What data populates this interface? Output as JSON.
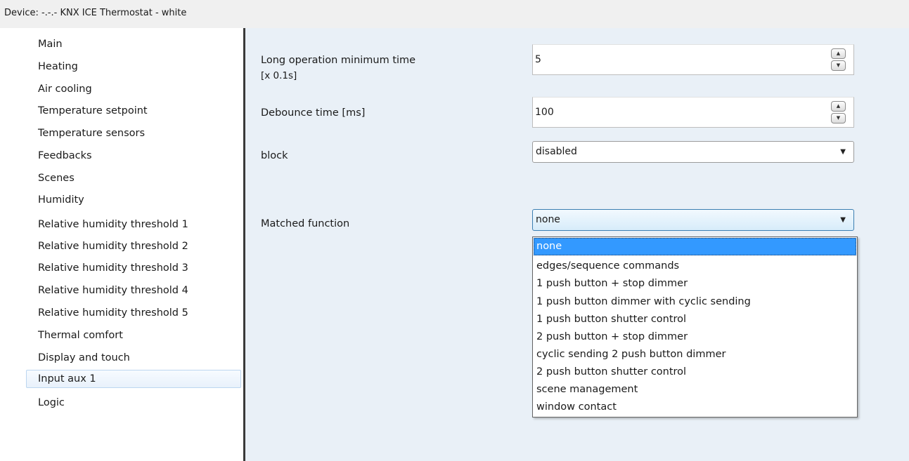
{
  "window": {
    "title": "Device: -.-.-  KNX ICE Thermostat - white"
  },
  "sidebar": {
    "items": [
      {
        "label": "Main"
      },
      {
        "label": "Heating"
      },
      {
        "label": "Air cooling"
      },
      {
        "label": "Temperature setpoint"
      },
      {
        "label": "Temperature sensors"
      },
      {
        "label": "Feedbacks"
      },
      {
        "label": "Scenes"
      },
      {
        "label": "Humidity"
      },
      {
        "label": "Relative humidity threshold 1"
      },
      {
        "label": "Relative humidity threshold 2"
      },
      {
        "label": "Relative humidity threshold 3"
      },
      {
        "label": "Relative humidity threshold 4"
      },
      {
        "label": "Relative humidity threshold 5"
      },
      {
        "label": "Thermal comfort"
      },
      {
        "label": "Display and touch"
      },
      {
        "label": "Input aux 1",
        "selected": true
      },
      {
        "label": "Logic"
      }
    ]
  },
  "params": {
    "long_op": {
      "label_line1": "Long operation minimum time",
      "label_line2": "[x 0.1s]",
      "value": "5"
    },
    "debounce": {
      "label": "Debounce time [ms]",
      "value": "100"
    },
    "block": {
      "label": "block",
      "value": "disabled"
    },
    "matched": {
      "label": "Matched function",
      "value": "none",
      "options": [
        "none",
        "edges/sequence commands",
        "1 push button + stop dimmer",
        "1 push button dimmer with cyclic sending",
        "1 push button shutter control",
        "2 push button + stop dimmer",
        "cyclic sending 2 push button dimmer",
        "2 push button shutter control",
        "scene management",
        "window contact"
      ],
      "highlighted_index": 0
    }
  },
  "icons": {
    "spin_up": "▲",
    "spin_down": "▼",
    "dropdown_arrow": "▼"
  },
  "colors": {
    "panel_bg": "#e9f0f7",
    "selection": "#3399ff",
    "focus_border": "#3c7fb1"
  }
}
